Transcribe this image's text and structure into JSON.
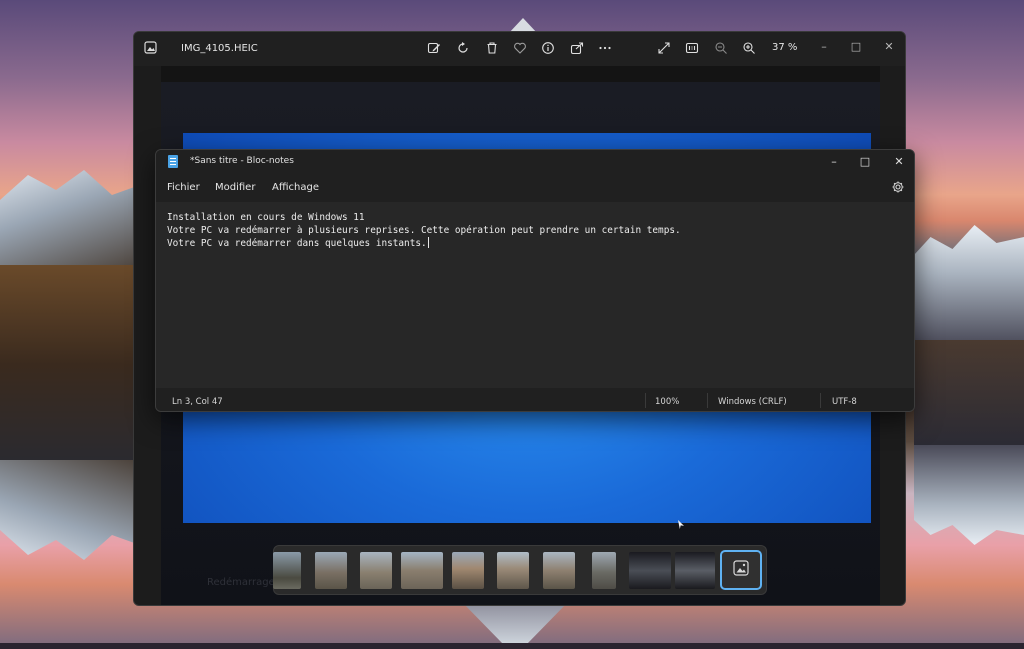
{
  "photos": {
    "filename": "IMG_4105.HEIC",
    "zoom_level": "37 %",
    "toolbar_icons": [
      "edit-icon",
      "rotate-icon",
      "delete-icon",
      "favorite-icon",
      "info-icon",
      "share-icon",
      "more-icon",
      "fullscreen-icon",
      "actual-size-icon",
      "zoom-out-icon",
      "zoom-in-icon"
    ],
    "photo_caption": "Redémarrage",
    "filmstrip_count": 10
  },
  "notepad": {
    "title": "*Sans titre - Bloc-notes",
    "menu": {
      "file": "Fichier",
      "edit": "Modifier",
      "view": "Affichage"
    },
    "lines": [
      "Installation en cours de Windows 11",
      "Votre PC va redémarrer à plusieurs reprises. Cette opération peut prendre un certain temps.",
      "Votre PC va redémarrer dans quelques instants."
    ],
    "status": {
      "position": "Ln 3, Col 47",
      "zoom": "100%",
      "line_ending": "Windows (CRLF)",
      "encoding": "UTF-8"
    }
  },
  "colors": {
    "accent": "#4aa3e6",
    "selection": "#5fb2f2",
    "screen_blue": "#1a6ad8"
  }
}
